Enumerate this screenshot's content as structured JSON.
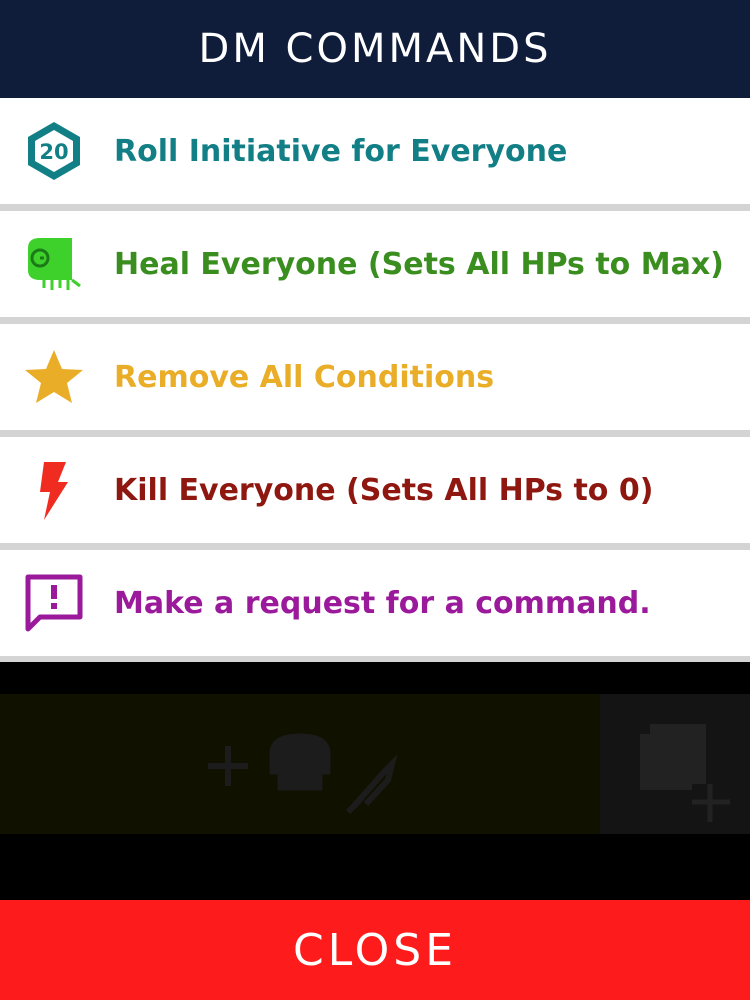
{
  "header": {
    "title": "DM COMMANDS"
  },
  "commands": [
    {
      "label": "Roll Initiative for Everyone",
      "color": "#127f86",
      "icon": "d20-icon",
      "icon_text": "20"
    },
    {
      "label": "Heal Everyone (Sets All HPs to Max)",
      "color": "#3a8e1f",
      "icon": "scroll-icon"
    },
    {
      "label": "Remove All Conditions",
      "color": "#e9ad28",
      "icon": "star-icon"
    },
    {
      "label": "Kill Everyone (Sets All HPs to 0)",
      "color": "#8e1710",
      "icon": "lightning-icon"
    },
    {
      "label": "Make a request for a command.",
      "color": "#9b1a9b",
      "icon": "feedback-icon"
    }
  ],
  "footer": {
    "close_label": "CLOSE",
    "color": "#fe1b1b"
  }
}
